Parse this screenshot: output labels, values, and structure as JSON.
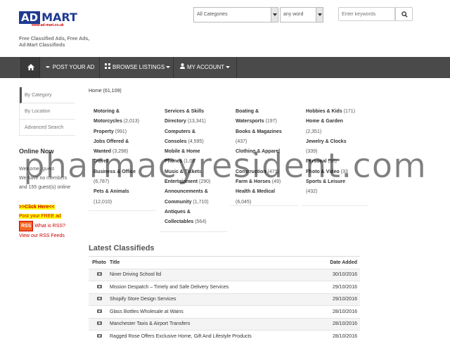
{
  "logo": {
    "part1": "AD",
    "part2": "MART",
    "url": "www.ad-mart.co.uk"
  },
  "tagline": [
    "Free Classified Ads, Free Ads,",
    "Ad-Mart Classifieds"
  ],
  "search": {
    "category_value": "All Categories",
    "match_value": "any word",
    "keywords_placeholder": "Enter keywords"
  },
  "nav": {
    "post": "POST YOUR AD",
    "browse": "BROWSE LISTINGS",
    "account": "MY ACCOUNT"
  },
  "sidebar": {
    "tabs": [
      "By Category",
      "By Location",
      "Advanced Search"
    ],
    "online_title": "Online Now",
    "online_lines": [
      "Welcome, guest",
      "We have no members",
      "and 155 guest(s) online"
    ],
    "click_here": ">>Click Here<<",
    "post_free": "Post your FREE ad",
    "rss_badge": "RSS",
    "rss_what": "What is RSS?",
    "rss_feeds": "View our RSS Feeds"
  },
  "breadcrumb": "Home (61,109)",
  "categories": {
    "col1": [
      {
        "name": "Motoring &",
        "count": ""
      },
      {
        "name": "Motorcycles",
        "count": "(2,013)"
      },
      {
        "name": "Property",
        "count": "(991)"
      },
      {
        "name": "Jobs Offered &",
        "count": ""
      },
      {
        "name": "Wanted",
        "count": "(3,298)"
      },
      {
        "name": "Travel",
        "count": ""
      },
      {
        "name": "Business & Office",
        "count": ""
      },
      {
        "name": "",
        "count": "(6,787)"
      },
      {
        "name": "Pets & Animals",
        "count": ""
      },
      {
        "name": "",
        "count": "(12,010)"
      }
    ],
    "col2": [
      {
        "name": "Services & Skills",
        "count": ""
      },
      {
        "name": "Directory",
        "count": "(13,341)"
      },
      {
        "name": "Computers &",
        "count": ""
      },
      {
        "name": "Consoles",
        "count": "(4,595)"
      },
      {
        "name": "Mobile & Home",
        "count": ""
      },
      {
        "name": "Phones",
        "count": "(1,08"
      },
      {
        "name": "Music & Tickets",
        "count": ""
      },
      {
        "name": "Entertainment",
        "count": "(290)"
      },
      {
        "name": "Announcements &",
        "count": ""
      },
      {
        "name": "Community",
        "count": "(1,710)"
      },
      {
        "name": "Antiques &",
        "count": ""
      },
      {
        "name": "Collectables",
        "count": "(564)"
      }
    ],
    "col3": [
      {
        "name": "Boating &",
        "count": ""
      },
      {
        "name": "Watersports",
        "count": "(197)"
      },
      {
        "name": "Books & Magazines",
        "count": ""
      },
      {
        "name": "",
        "count": "(437)"
      },
      {
        "name": "Clothing & Apparel",
        "count": ""
      },
      {
        "name": "",
        "count": ""
      },
      {
        "name": "Construction",
        "count": "(471)"
      },
      {
        "name": "Farm & Horses",
        "count": "(49)"
      },
      {
        "name": "Health & Medical",
        "count": ""
      },
      {
        "name": "",
        "count": "(6,045)"
      }
    ],
    "col4": [
      {
        "name": "Hobbies & Kids",
        "count": "(171)"
      },
      {
        "name": "Home & Garden",
        "count": ""
      },
      {
        "name": "",
        "count": "(2,351)"
      },
      {
        "name": "Jewelry & Clocks",
        "count": ""
      },
      {
        "name": "",
        "count": "(339)"
      },
      {
        "name": "Personal",
        "count": "(36)"
      },
      {
        "name": "Photo & Video",
        "count": "(33"
      },
      {
        "name": "Sports & Leisure",
        "count": ""
      },
      {
        "name": "",
        "count": "(432)"
      }
    ]
  },
  "latest": {
    "title": "Latest Classifieds",
    "headers": {
      "photo": "Photo",
      "title": "Title",
      "date": "Date Added"
    },
    "rows": [
      {
        "title": "Niner Driving School ltd",
        "date": "30/10/2016"
      },
      {
        "title": "Mission Despatch – Timely and Safe Delivery Services",
        "date": "29/10/2016"
      },
      {
        "title": "Shopify Store Design Services",
        "date": "29/10/2016"
      },
      {
        "title": "Glass Bottles Wholesale at Wains",
        "date": "28/10/2016"
      },
      {
        "title": "Manchester Taxis & Airport Transfers",
        "date": "28/10/2016"
      },
      {
        "title": "Ragged Rose Offers Exclusive Home, Gift And Lifestyle Products",
        "date": "28/10/2016"
      }
    ]
  },
  "watermark": "pharmacyresident.com"
}
